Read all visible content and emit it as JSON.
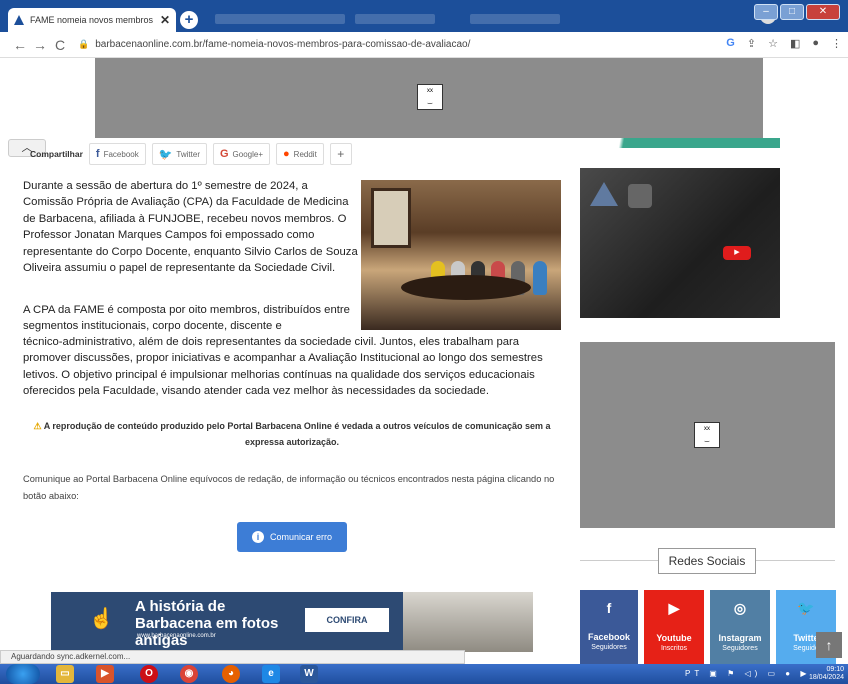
{
  "browser": {
    "tab_title": "FAME nomeia novos membros p",
    "tab_close": "✕",
    "new_tab": "+",
    "url": "barbacenaonline.com.br/fame-nomeia-novos-membros-para-comissao-de-avaliacao/",
    "status": "Aguardando sync.adkernel.com..."
  },
  "share": {
    "label": "Compartilhar",
    "facebook": "Facebook",
    "twitter": "Twitter",
    "google": "Google+",
    "reddit": "Reddit",
    "more": "+"
  },
  "article": {
    "p1": "Durante a sessão de abertura do 1º semestre de 2024, a Comissão Própria de Avaliação (CPA) da Faculdade de Medicina de Barbacena, afiliada à FUNJOBE, recebeu novos membros. O Professor Jonatan Marques Campos foi empossado como representante do Corpo Docente, enquanto Silvio Carlos de Souza Oliveira assumiu o papel de representante da Sociedade Civil.",
    "p2a": "A CPA da FAME é composta por oito membros, distribuídos entre segmentos institucionais, corpo docente, discente e",
    "p2b": "técnico-administrativo, além de dois representantes da sociedade civil. Juntos, eles trabalham para promover discussões, propor iniciativas e acompanhar a Avaliação Institucional ao longo dos semestres letivos. O objetivo principal é impulsionar melhorias contínuas na qualidade dos serviços educacionais oferecidos pela Faculdade, visando atender cada vez melhor às necessidades da sociedade.",
    "warning": "A reprodução de conteúdo produzido pelo Portal Barbacena Online é vedada a outros veículos de comunicação sem a expressa autorização.",
    "report": "Comunique ao Portal Barbacena Online equívocos de redação, de informação ou técnicos encontrados nesta página clicando no botão abaixo:",
    "report_button": "Comunicar erro"
  },
  "banner": {
    "title": "A história de Barbacena em fotos antigas",
    "site": "www.barbacenaonline.com.br",
    "cta": "CONFIRA"
  },
  "sidebar": {
    "redes_title": "Redes Sociais",
    "social": [
      {
        "name": "Facebook",
        "sub": "Seguidores",
        "icon": "f",
        "color": "#3b5998"
      },
      {
        "name": "Youtube",
        "sub": "Inscritos",
        "icon": "▶",
        "color": "#e62117"
      },
      {
        "name": "Instagram",
        "sub": "Seguidores",
        "icon": "◎",
        "color": "#517fa4"
      },
      {
        "name": "Twitte",
        "sub": "Seguido",
        "icon": "🐦",
        "color": "#55acee"
      }
    ]
  },
  "taskbar": {
    "time": "09:10",
    "date": "18/04/2024",
    "lang": "PT"
  }
}
